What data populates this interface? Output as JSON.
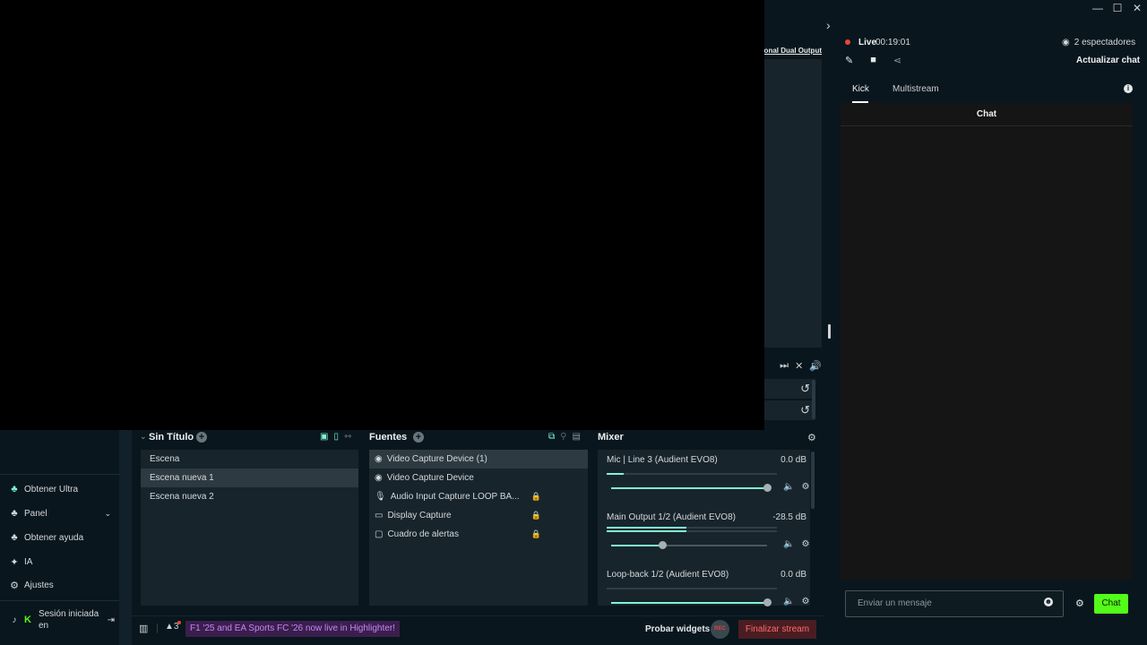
{
  "window": {
    "controls": [
      "—",
      "☐",
      "✕"
    ]
  },
  "preview": {
    "dual_output_label": "Optional Dual Output"
  },
  "left_nav": {
    "items": [
      {
        "icon": "ultra-icon",
        "label": "Obtener Ultra"
      },
      {
        "icon": "panel-icon",
        "label": "Panel"
      },
      {
        "icon": "help-icon",
        "label": "Obtener ayuda"
      },
      {
        "icon": "ai-sparkle-icon",
        "label": "IA"
      },
      {
        "icon": "gear-icon",
        "label": "Ajustes"
      }
    ],
    "session_label": "Sesión iniciada en"
  },
  "scenes": {
    "collection_title": "Sin Título",
    "items": [
      "Escena",
      "Escena nueva 1",
      "Escena nueva 2"
    ],
    "selected": "Escena nueva 1"
  },
  "sources": {
    "title": "Fuentes",
    "items": [
      {
        "icon": "webcam-icon",
        "label": "Video Capture Device (1)",
        "locked": false
      },
      {
        "icon": "webcam-icon",
        "label": "Video Capture Device",
        "locked": false
      },
      {
        "icon": "microphone-icon",
        "label": "Audio Input Capture LOOP BA...",
        "locked": true
      },
      {
        "icon": "monitor-icon",
        "label": "Display Capture",
        "locked": true
      },
      {
        "icon": "alert-box-icon",
        "label": "Cuadro de alertas",
        "locked": true
      }
    ],
    "selected": "Video Capture Device (1)"
  },
  "mixer": {
    "title": "Mixer",
    "channels": [
      {
        "name": "Mic | Line 3 (Audient EVO8)",
        "db": "0.0 dB",
        "volume": 1.0,
        "meter": 0.1
      },
      {
        "name": "Main Output 1/2 (Audient EVO8)",
        "db": "-28.5 dB",
        "volume": 0.33,
        "meter": 0.47
      },
      {
        "name": "Loop-back 1/2 (Audient EVO8)",
        "db": "0.0 dB",
        "volume": 1.0,
        "meter": 0.0
      }
    ]
  },
  "status_bar": {
    "alerts_count": "3",
    "ticker": "F1 '25 and EA Sports FC '26 now live in Highlighter!",
    "test_widgets": "Probar widgets",
    "rec_label": "REC",
    "end_stream": "Finalizar stream"
  },
  "stream": {
    "live_label": "Live",
    "time": "00:19:01",
    "viewers": "2 espectadores",
    "refresh_chat": "Actualizar chat",
    "tabs": [
      "Kick",
      "Multistream"
    ],
    "active_tab": "Kick",
    "chat_title": "Chat",
    "chat_placeholder": "Enviar un mensaje",
    "chat_button": "Chat"
  },
  "colors": {
    "accent": "#80f5d2",
    "kick_green": "#53fc18",
    "live_red": "#e9453b",
    "end_stream_red": "#ff6a6a"
  }
}
